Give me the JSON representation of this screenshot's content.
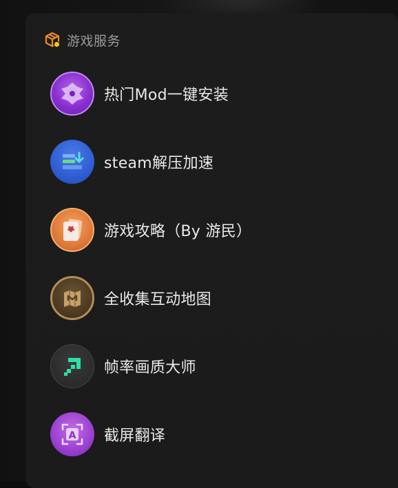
{
  "header": {
    "title": "游戏服务",
    "icon": "box-icon"
  },
  "items": [
    {
      "label": "热门Mod一键安装",
      "icon": "mod-install-icon",
      "color": "#8a2fd0"
    },
    {
      "label": "steam解压加速",
      "icon": "steam-accelerate-icon",
      "color": "#2f5ed4"
    },
    {
      "label": "游戏攻略（By 游民）",
      "icon": "game-guide-icon",
      "color": "#e07a3a"
    },
    {
      "label": "全收集互动地图",
      "icon": "interactive-map-icon",
      "color": "#4a3820"
    },
    {
      "label": "帧率画质大师",
      "icon": "fps-quality-icon",
      "color": "#2b2b2b"
    },
    {
      "label": "截屏翻译",
      "icon": "screenshot-translate-icon",
      "color": "#9a3fd0"
    }
  ],
  "colors": {
    "panel_bg": "#1c1c1c",
    "accent_orange": "#f08a24",
    "text_primary": "#e9e9e9",
    "text_secondary": "#9a9a9a"
  }
}
